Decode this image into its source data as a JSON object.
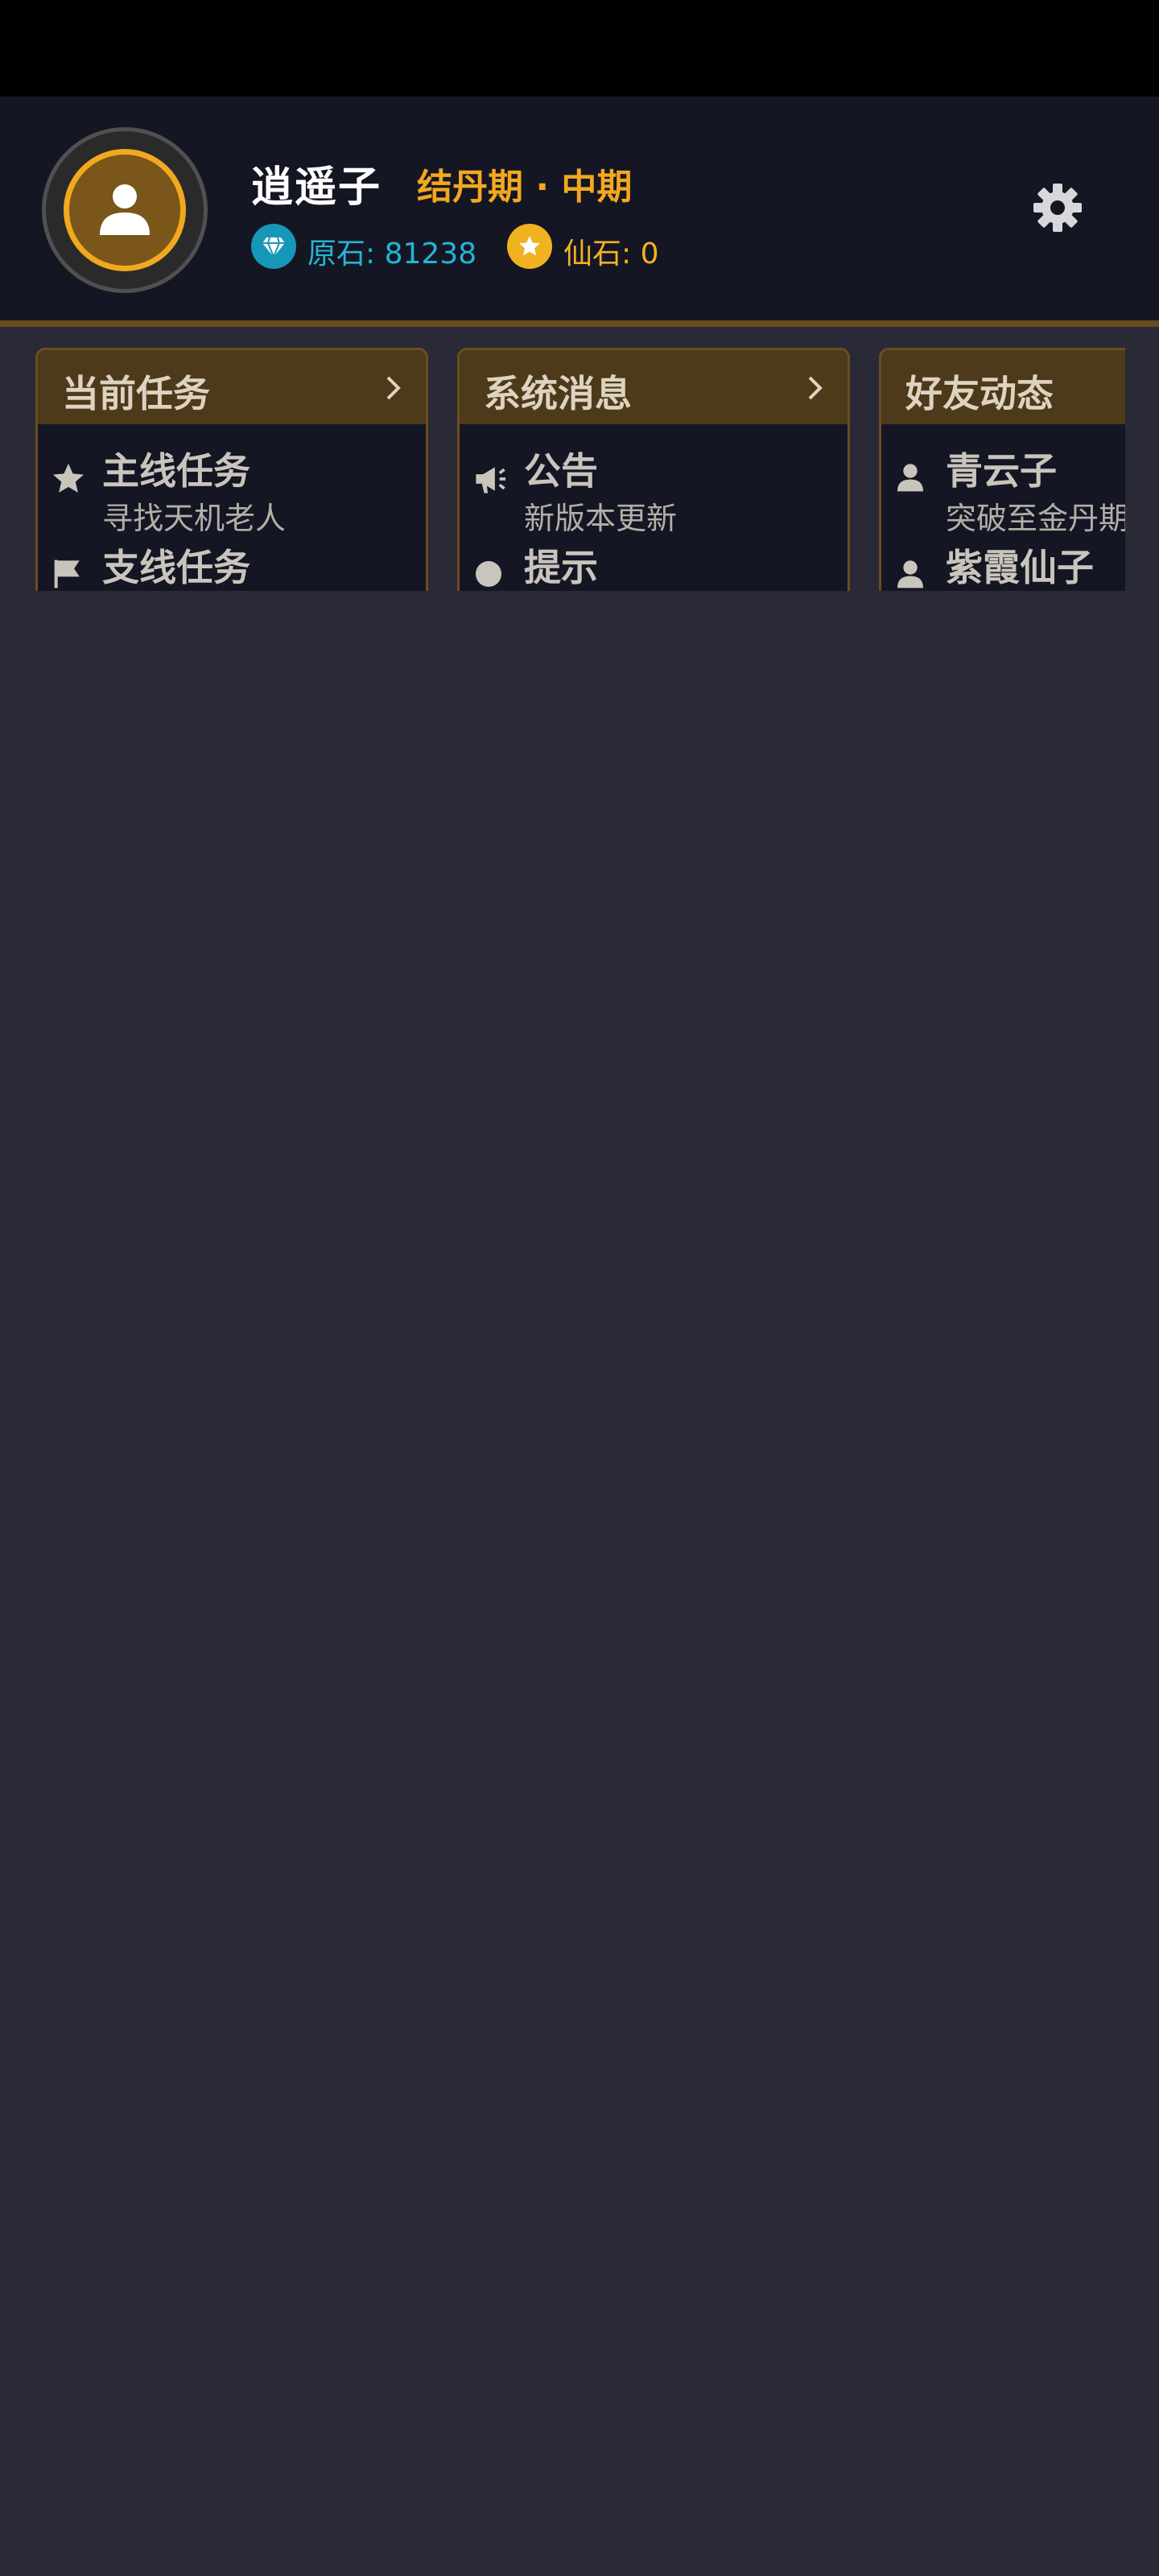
{
  "player": {
    "name": "逍遥子",
    "realm": "结丹期 · 中期",
    "avatar_progress": 0.05
  },
  "currencies": {
    "gem_label": "原石: 81238",
    "coin_label": "仙石: 0"
  },
  "cards": {
    "tasks": {
      "title": "当前任务",
      "rows": [
        {
          "icon": "star-icon",
          "title": "主线任务",
          "subtitle": "寻找天机老人"
        },
        {
          "icon": "flag-icon",
          "title": "支线任务",
          "subtitle": ""
        }
      ]
    },
    "system": {
      "title": "系统消息",
      "rows": [
        {
          "icon": "megaphone-icon",
          "title": "公告",
          "subtitle": "新版本更新"
        },
        {
          "icon": "info-icon",
          "title": "提示",
          "subtitle": ""
        }
      ]
    },
    "friends": {
      "title": "好友动态",
      "rows": [
        {
          "icon": "person-icon",
          "title": "青云子",
          "subtitle": "突破至金丹期"
        },
        {
          "icon": "person-icon",
          "title": "紫霞仙子",
          "subtitle": ""
        }
      ]
    }
  },
  "colors": {
    "accent": "#f2a81f",
    "gem": "#22b6d6",
    "card_header": "#4d3a1b",
    "background": "#292a36"
  }
}
